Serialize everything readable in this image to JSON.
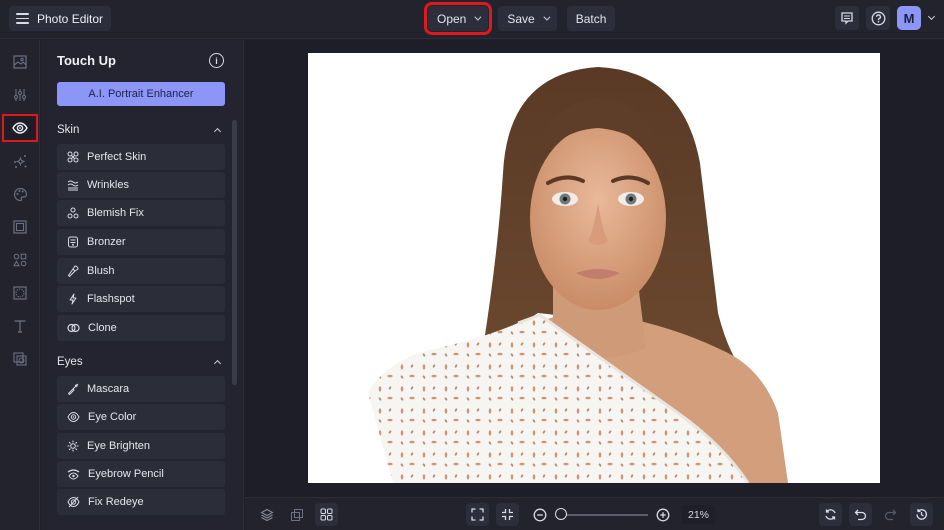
{
  "app": {
    "title": "Photo Editor"
  },
  "topbar": {
    "open_label": "Open",
    "save_label": "Save",
    "batch_label": "Batch",
    "avatar_initial": "M",
    "highlight_color": "#e0181f"
  },
  "rail": {
    "items": [
      {
        "name": "image",
        "icon": "image-icon"
      },
      {
        "name": "adjust",
        "icon": "sliders-icon"
      },
      {
        "name": "touch-up",
        "icon": "eye-icon",
        "active": true
      },
      {
        "name": "effects",
        "icon": "sparkle-icon"
      },
      {
        "name": "artsy",
        "icon": "palette-icon"
      },
      {
        "name": "frames",
        "icon": "frame-icon"
      },
      {
        "name": "graphics",
        "icon": "shapes-icon"
      },
      {
        "name": "overlays",
        "icon": "overlay-icon"
      },
      {
        "name": "text",
        "icon": "text-icon"
      },
      {
        "name": "textures",
        "icon": "texture-icon"
      }
    ]
  },
  "panel": {
    "title": "Touch Up",
    "ai_button": "A.I. Portrait Enhancer",
    "accent_color": "#8c96f7",
    "sections": [
      {
        "title": "Skin",
        "tools": [
          {
            "label": "Perfect Skin",
            "icon": "perfect-skin-icon"
          },
          {
            "label": "Wrinkles",
            "icon": "wrinkles-icon"
          },
          {
            "label": "Blemish Fix",
            "icon": "blemish-fix-icon"
          },
          {
            "label": "Bronzer",
            "icon": "bronzer-icon"
          },
          {
            "label": "Blush",
            "icon": "blush-brush-icon"
          },
          {
            "label": "Flashspot",
            "icon": "flashspot-icon"
          },
          {
            "label": "Clone",
            "icon": "clone-icon"
          }
        ]
      },
      {
        "title": "Eyes",
        "tools": [
          {
            "label": "Mascara",
            "icon": "mascara-icon"
          },
          {
            "label": "Eye Color",
            "icon": "eye-color-icon"
          },
          {
            "label": "Eye Brighten",
            "icon": "eye-brighten-icon"
          },
          {
            "label": "Eyebrow Pencil",
            "icon": "eyebrow-pencil-icon"
          },
          {
            "label": "Fix Redeye",
            "icon": "fix-redeye-icon"
          }
        ]
      }
    ]
  },
  "canvas": {
    "photo_description": "Portrait of a woman with long brown hair wearing a white one-shoulder eyelet top on a white background"
  },
  "bottombar": {
    "zoom_percent": "21%",
    "zoom_level": 0.21
  }
}
